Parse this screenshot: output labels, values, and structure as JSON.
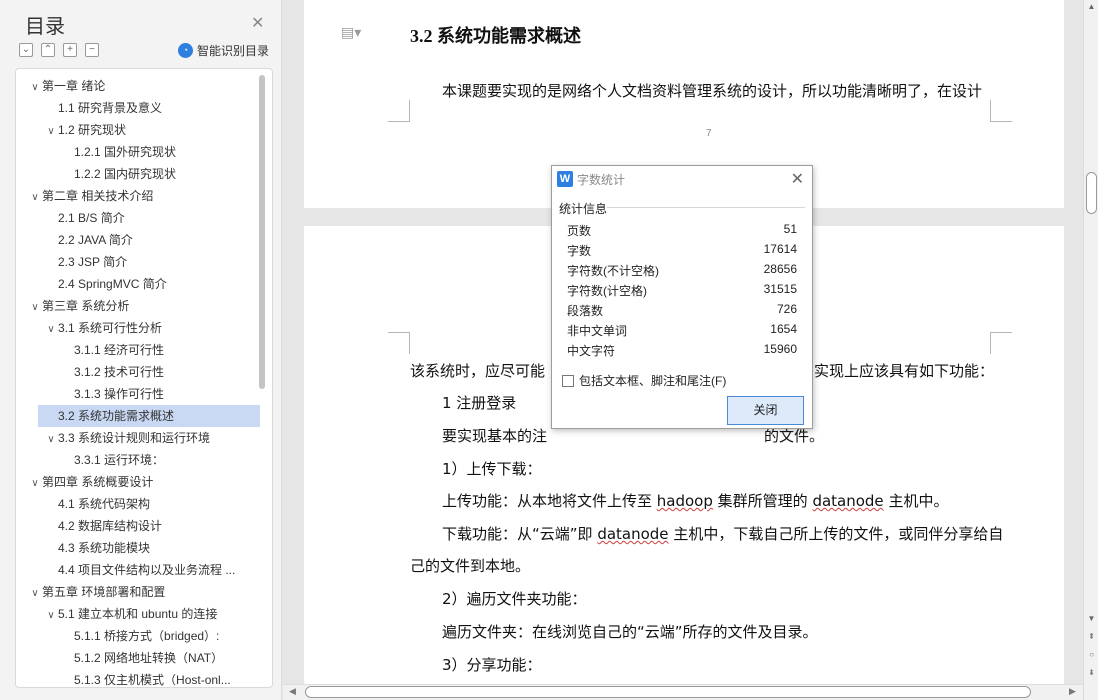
{
  "nav": {
    "title": "目录",
    "close_icon": "close-icon",
    "smart_toc_label": "智能识别目录",
    "tools": [
      "collapse-all",
      "expand-level",
      "add",
      "remove"
    ],
    "toc": [
      {
        "level": 1,
        "arrow": "down",
        "label": "第一章  绪论",
        "selected": false
      },
      {
        "level": 2,
        "arrow": "",
        "label": "1.1 研究背景及意义",
        "selected": false
      },
      {
        "level": 2,
        "arrow": "down",
        "label": "1.2 研究现状",
        "selected": false
      },
      {
        "level": 3,
        "arrow": "",
        "label": "1.2.1 国外研究现状",
        "selected": false
      },
      {
        "level": 3,
        "arrow": "",
        "label": "1.2.2 国内研究现状",
        "selected": false
      },
      {
        "level": 1,
        "arrow": "down",
        "label": "第二章  相关技术介绍",
        "selected": false
      },
      {
        "level": 2,
        "arrow": "",
        "label": "2.1 B/S  简介",
        "selected": false
      },
      {
        "level": 2,
        "arrow": "",
        "label": "2.2 JAVA  简介",
        "selected": false
      },
      {
        "level": 2,
        "arrow": "",
        "label": "2.3 JSP  简介",
        "selected": false
      },
      {
        "level": 2,
        "arrow": "",
        "label": "2.4 SpringMVC 简介",
        "selected": false
      },
      {
        "level": 1,
        "arrow": "down",
        "label": "第三章  系统分析",
        "selected": false
      },
      {
        "level": 2,
        "arrow": "down",
        "label": "3.1 系统可行性分析",
        "selected": false
      },
      {
        "level": 3,
        "arrow": "",
        "label": "3.1.1    经济可行性",
        "selected": false
      },
      {
        "level": 3,
        "arrow": "",
        "label": "3.1.2  技术可行性",
        "selected": false
      },
      {
        "level": 3,
        "arrow": "",
        "label": "3.1.3  操作可行性",
        "selected": false
      },
      {
        "level": 2,
        "arrow": "",
        "label": "3.2 系统功能需求概述",
        "selected": true
      },
      {
        "level": 2,
        "arrow": "down",
        "label": "3.3 系统设计规则和运行环境",
        "selected": false
      },
      {
        "level": 3,
        "arrow": "",
        "label": "3.3.1 运行环境：",
        "selected": false
      },
      {
        "level": 1,
        "arrow": "down",
        "label": "第四章  系统概要设计",
        "selected": false
      },
      {
        "level": 2,
        "arrow": "",
        "label": "4.1 系统代码架构",
        "selected": false
      },
      {
        "level": 2,
        "arrow": "",
        "label": "4.2 数据库结构设计",
        "selected": false
      },
      {
        "level": 2,
        "arrow": "",
        "label": "4.3  系统功能模块",
        "selected": false
      },
      {
        "level": 2,
        "arrow": "",
        "label": "4.4  项目文件结构以及业务流程 ...",
        "selected": false
      },
      {
        "level": 1,
        "arrow": "down",
        "label": "第五章  环境部署和配置",
        "selected": false
      },
      {
        "level": 2,
        "arrow": "down",
        "label": "5.1  建立本机和 ubuntu 的连接",
        "selected": false
      },
      {
        "level": 3,
        "arrow": "",
        "label": "5.1.1  桥接方式（bridged）:",
        "selected": false
      },
      {
        "level": 3,
        "arrow": "",
        "label": "5.1.2  网络地址转换（NAT）",
        "selected": false
      },
      {
        "level": 3,
        "arrow": "",
        "label": "5.1.3  仅主机模式（Host-onl...",
        "selected": false
      }
    ]
  },
  "doc": {
    "heading": "3.2 系统功能需求概述",
    "intro": "本课题要实现的是网络个人文档资料管理系统的设计，所以功能清晰明了，在设计",
    "page_number": "7",
    "continued_left": "该系统时，应尽可能",
    "continued_right": "实现上应该具有如下功能：",
    "item1": "1    注册登录",
    "para1_left": "要实现基本的注",
    "para1_right": "的文件。",
    "upload_heading": "1）上传下载：",
    "upload_pre": "上传功能：从本地将文件上传至 ",
    "upload_hadoop": "hadoop",
    "upload_mid": " 集群所管理的 ",
    "upload_datanode": "datanode",
    "upload_post": " 主机中。",
    "download_pre": "下载功能：从“云端”即 ",
    "download_datanode": "datanode",
    "download_post": " 主机中，下载自己所上传的文件，或同伴分享给自",
    "download_cont": "己的文件到本地。",
    "browse_heading": "2）遍历文件夹功能：",
    "browse_text": "遍历文件夹：在线浏览自己的“云端”所存的文件及目录。",
    "share_heading": "3）分享功能："
  },
  "dialog": {
    "logo": "W",
    "title": "字数统计",
    "group_label": "统计信息",
    "stats": [
      {
        "label": "页数",
        "value": "51"
      },
      {
        "label": "字数",
        "value": "17614"
      },
      {
        "label": "字符数(不计空格)",
        "value": "28656"
      },
      {
        "label": "字符数(计空格)",
        "value": "31515"
      },
      {
        "label": "段落数",
        "value": "726"
      },
      {
        "label": "非中文单词",
        "value": "1654"
      },
      {
        "label": "中文字符",
        "value": "15960"
      }
    ],
    "checkbox_label": "包括文本框、脚注和尾注(F)",
    "checkbox_checked": false,
    "close_button": "关闭"
  },
  "colors": {
    "selected_row": "#c9d9f3",
    "accent": "#2d7fe0",
    "dialog_button": "#dceaf9"
  }
}
